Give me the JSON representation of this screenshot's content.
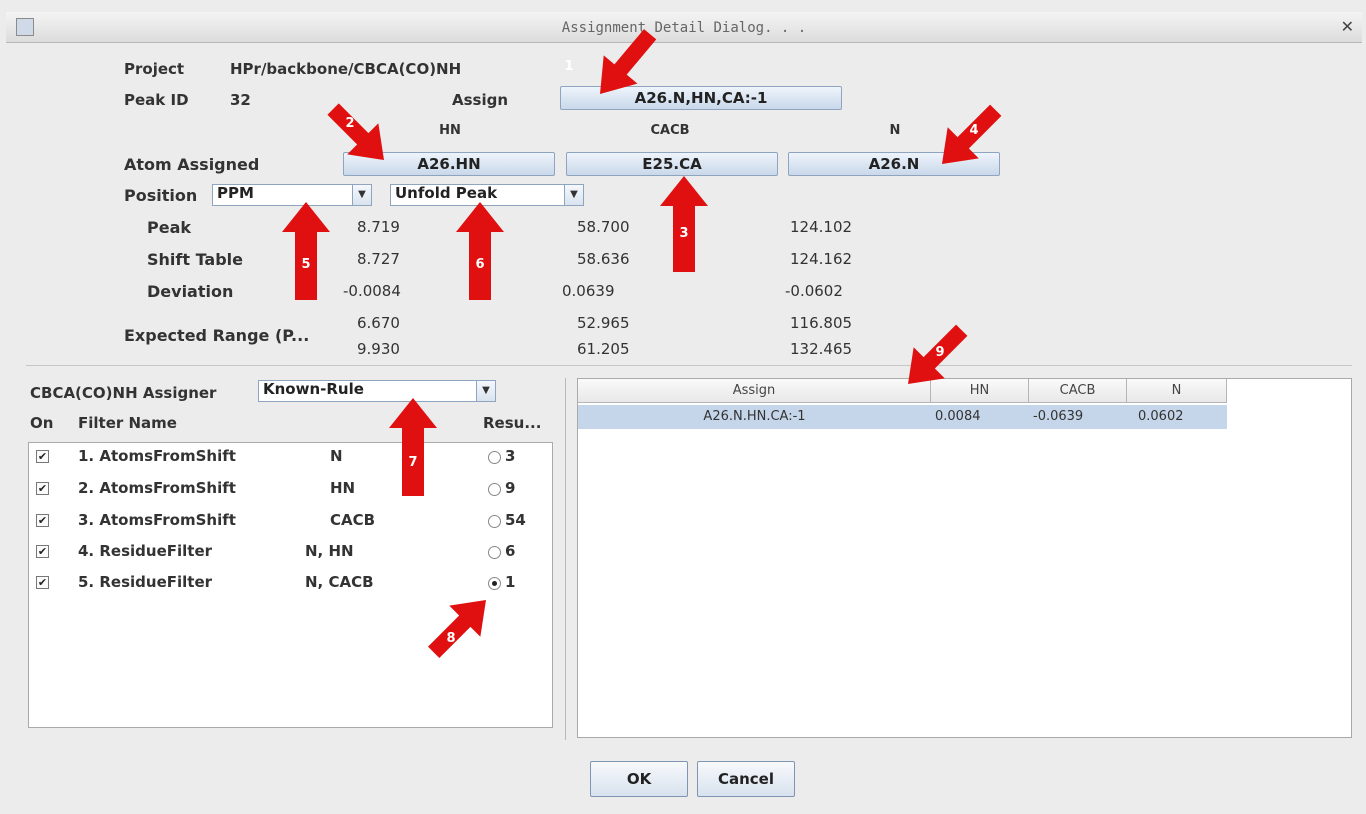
{
  "window": {
    "title": "Assignment Detail Dialog. . ."
  },
  "project": {
    "label": "Project",
    "value": "HPr/backbone/CBCA(CO)NH"
  },
  "peak_id": {
    "label": "Peak ID",
    "value": "32"
  },
  "assign": {
    "label": "Assign",
    "button": "A26.N,HN,CA:-1"
  },
  "columns": {
    "hn": "HN",
    "cacb": "CACB",
    "n": "N"
  },
  "atom_assigned": {
    "label": "Atom Assigned",
    "hn": "A26.HN",
    "cacb": "E25.CA",
    "n": "A26.N"
  },
  "position": {
    "label": "Position",
    "units": "PPM",
    "peak_mode": "Unfold Peak"
  },
  "rows": {
    "peak": {
      "label": "Peak",
      "hn": "8.719",
      "cacb": "58.700",
      "n": "124.102"
    },
    "shift": {
      "label": "Shift Table",
      "hn": "8.727",
      "cacb": "58.636",
      "n": "124.162"
    },
    "deviation": {
      "label": "Deviation",
      "hn": "-0.0084",
      "cacb": "0.0639",
      "n": "-0.0602"
    },
    "expected": {
      "label": "Expected Range (P...",
      "hn_low": "6.670",
      "hn_high": "9.930",
      "cacb_low": "52.965",
      "cacb_high": "61.205",
      "n_low": "116.805",
      "n_high": "132.465"
    }
  },
  "assigner": {
    "label": "CBCA(CO)NH Assigner",
    "value": "Known-Rule"
  },
  "filters": {
    "headers": {
      "on": "On",
      "name": "Filter Name",
      "result": "Resu..."
    },
    "items": [
      {
        "name": "1. AtomsFromShift",
        "atoms": "N",
        "result": "3",
        "selected": false
      },
      {
        "name": "2. AtomsFromShift",
        "atoms": "HN",
        "result": "9",
        "selected": false
      },
      {
        "name": "3. AtomsFromShift",
        "atoms": "CACB",
        "result": "54",
        "selected": false
      },
      {
        "name": "4. ResidueFilter",
        "atoms": "N, HN",
        "result": "6",
        "selected": false
      },
      {
        "name": "5. ResidueFilter",
        "atoms": "N, CACB",
        "result": "1",
        "selected": true
      }
    ]
  },
  "results_table": {
    "headers": [
      "Assign",
      "HN",
      "CACB",
      "N"
    ],
    "rows": [
      [
        "A26.N.HN.CA:-1",
        "0.0084",
        "-0.0639",
        "0.0602"
      ]
    ]
  },
  "buttons": {
    "ok": "OK",
    "cancel": "Cancel"
  },
  "annotations": [
    "1",
    "2",
    "3",
    "4",
    "5",
    "6",
    "7",
    "8",
    "9"
  ],
  "colors": {
    "annotation": "#e01010",
    "selection": "#c5d6ea",
    "button_top": "#eef4fb",
    "button_bottom": "#c9d8ea"
  }
}
